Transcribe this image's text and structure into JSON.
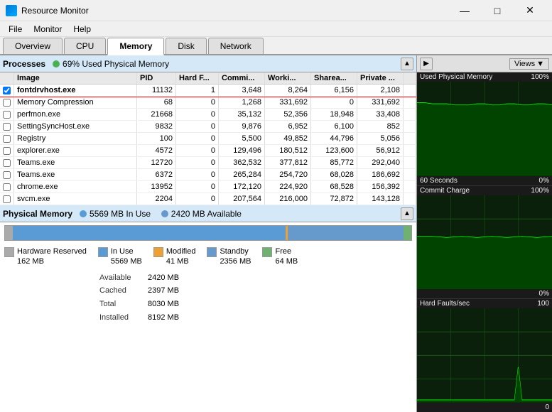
{
  "titlebar": {
    "title": "Resource Monitor",
    "icon": "monitor-icon",
    "min_btn": "—",
    "max_btn": "□",
    "close_btn": "✕"
  },
  "menubar": {
    "items": [
      "File",
      "Monitor",
      "Help"
    ]
  },
  "tabs": [
    {
      "label": "Overview",
      "active": false
    },
    {
      "label": "CPU",
      "active": false
    },
    {
      "label": "Memory",
      "active": true
    },
    {
      "label": "Disk",
      "active": false
    },
    {
      "label": "Network",
      "active": false
    }
  ],
  "processes": {
    "section_title": "Processes",
    "status_text": "69% Used Physical Memory",
    "columns": [
      "",
      "Image",
      "PID",
      "Hard F...",
      "Commi...",
      "Worki...",
      "Sharea...",
      "Private ...",
      ""
    ],
    "rows": [
      {
        "checked": true,
        "image": "fontdrvhost.exe",
        "pid": "11132",
        "hard_f": "1",
        "commit": "3,648",
        "working": "8,264",
        "shared": "6,156",
        "private": "2,108",
        "selected": true
      },
      {
        "checked": false,
        "image": "Memory Compression",
        "pid": "68",
        "hard_f": "0",
        "commit": "1,268",
        "working": "331,692",
        "shared": "0",
        "private": "331,692",
        "selected": false
      },
      {
        "checked": false,
        "image": "perfmon.exe",
        "pid": "21668",
        "hard_f": "0",
        "commit": "35,132",
        "working": "52,356",
        "shared": "18,948",
        "private": "33,408",
        "selected": false
      },
      {
        "checked": false,
        "image": "SettingSyncHost.exe",
        "pid": "9832",
        "hard_f": "0",
        "commit": "9,876",
        "working": "6,952",
        "shared": "6,100",
        "private": "852",
        "selected": false
      },
      {
        "checked": false,
        "image": "Registry",
        "pid": "100",
        "hard_f": "0",
        "commit": "5,500",
        "working": "49,852",
        "shared": "44,796",
        "private": "5,056",
        "selected": false
      },
      {
        "checked": false,
        "image": "explorer.exe",
        "pid": "4572",
        "hard_f": "0",
        "commit": "129,496",
        "working": "180,512",
        "shared": "123,600",
        "private": "56,912",
        "selected": false
      },
      {
        "checked": false,
        "image": "Teams.exe",
        "pid": "12720",
        "hard_f": "0",
        "commit": "362,532",
        "working": "377,812",
        "shared": "85,772",
        "private": "292,040",
        "selected": false
      },
      {
        "checked": false,
        "image": "Teams.exe",
        "pid": "6372",
        "hard_f": "0",
        "commit": "265,284",
        "working": "254,720",
        "shared": "68,028",
        "private": "186,692",
        "selected": false
      },
      {
        "checked": false,
        "image": "chrome.exe",
        "pid": "13952",
        "hard_f": "0",
        "commit": "172,120",
        "working": "224,920",
        "shared": "68,528",
        "private": "156,392",
        "selected": false
      },
      {
        "checked": false,
        "image": "svcm.exe",
        "pid": "2204",
        "hard_f": "0",
        "commit": "207,564",
        "working": "216,000",
        "shared": "72,872",
        "private": "143,128",
        "selected": false
      }
    ]
  },
  "physical_memory": {
    "section_title": "Physical Memory",
    "inuse_text": "5569 MB In Use",
    "available_text": "2420 MB Available",
    "legend": [
      {
        "label": "Hardware Reserved",
        "sub": "162 MB",
        "color": "#aaaaaa"
      },
      {
        "label": "In Use",
        "sub": "5569 MB",
        "color": "#5b9bd5"
      },
      {
        "label": "Modified",
        "sub": "41 MB",
        "color": "#f0a030"
      },
      {
        "label": "Standby",
        "sub": "2356 MB",
        "color": "#6699cc"
      },
      {
        "label": "Free",
        "sub": "64 MB",
        "color": "#70b070"
      }
    ],
    "stats": [
      {
        "label": "Available",
        "value": "2420 MB"
      },
      {
        "label": "Cached",
        "value": "2397 MB"
      },
      {
        "label": "Total",
        "value": "8030 MB"
      },
      {
        "label": "Installed",
        "value": "8192 MB"
      }
    ]
  },
  "charts": {
    "views_label": "Views",
    "sections": [
      {
        "title": "Used Physical Memory",
        "top_pct": "100%",
        "bottom_pct": "0%",
        "seconds": "60 Seconds"
      },
      {
        "title": "Commit Charge",
        "top_pct": "100%",
        "bottom_pct": "0%",
        "seconds": ""
      },
      {
        "title": "Hard Faults/sec",
        "top_pct": "100",
        "bottom_pct": "0",
        "seconds": ""
      }
    ]
  }
}
